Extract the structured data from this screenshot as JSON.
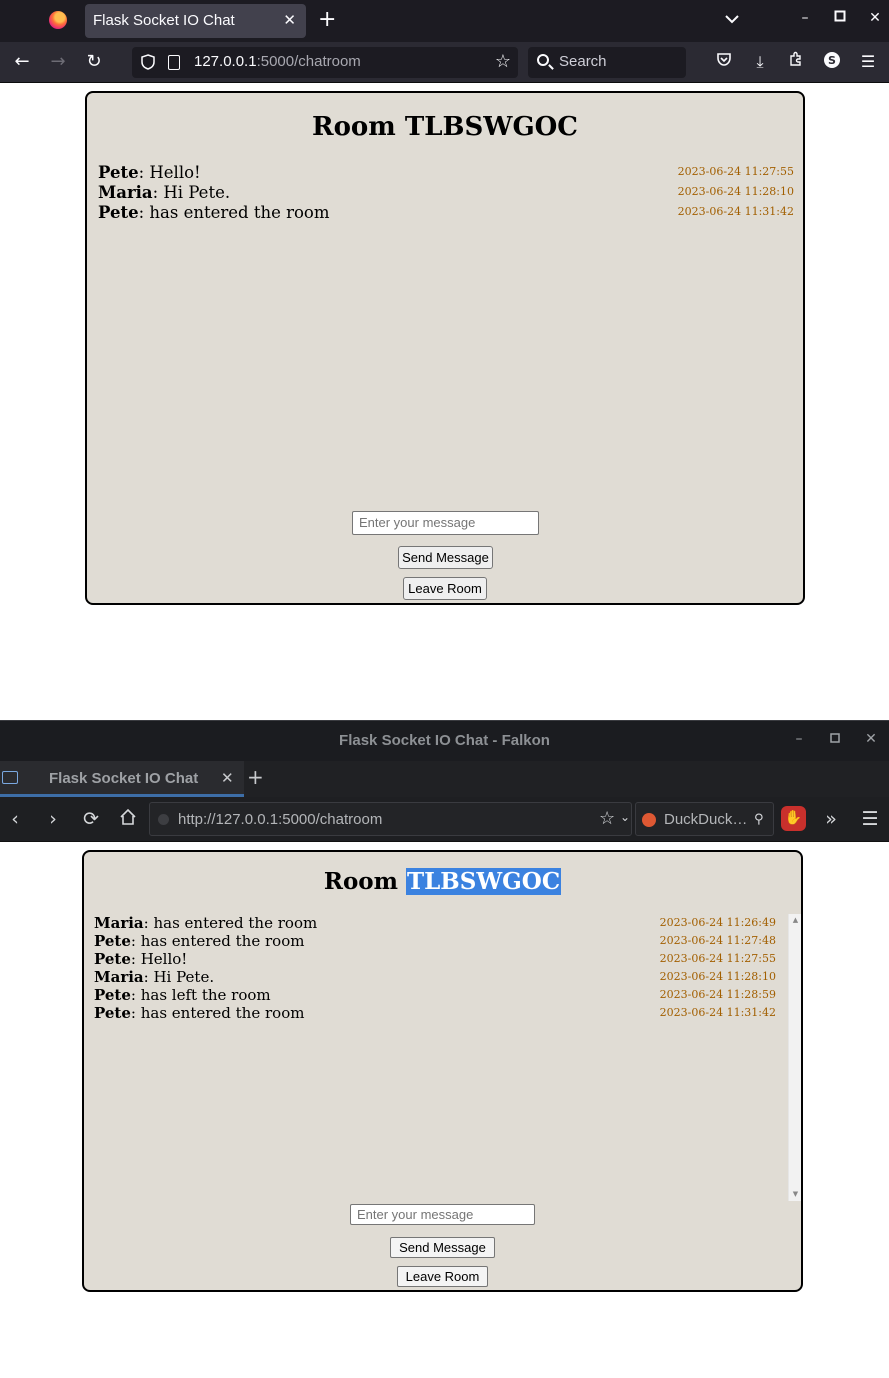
{
  "firefox": {
    "tab_title": "Flask Socket IO Chat",
    "url_host": "127.0.0.1",
    "url_rest": ":5000/chatroom",
    "search_placeholder": "Search",
    "page": {
      "room_label": "Room",
      "room_code": "TLBSWGOC",
      "messages": [
        {
          "user": "Pete",
          "text": ": Hello!",
          "time": "2023-06-24 11:27:55"
        },
        {
          "user": "Maria",
          "text": ": Hi Pete.",
          "time": "2023-06-24 11:28:10"
        },
        {
          "user": "Pete",
          "text": ": has entered the room",
          "time": "2023-06-24 11:31:42"
        }
      ],
      "input_placeholder": "Enter your message",
      "send_label": "Send Message",
      "leave_label": "Leave Room"
    }
  },
  "falkon": {
    "window_title": "Flask Socket IO Chat - Falkon",
    "tab_title": "Flask Socket IO Chat",
    "url": "http://127.0.0.1:5000/chatroom",
    "search_engine": "DuckDuck…",
    "page": {
      "room_label": "Room",
      "room_code": "TLBSWGOC",
      "messages": [
        {
          "user": "Maria",
          "text": ": has entered the room",
          "time": "2023-06-24 11:26:49"
        },
        {
          "user": "Pete",
          "text": ": has entered the room",
          "time": "2023-06-24 11:27:48"
        },
        {
          "user": "Pete",
          "text": ": Hello!",
          "time": "2023-06-24 11:27:55"
        },
        {
          "user": "Maria",
          "text": ": Hi Pete.",
          "time": "2023-06-24 11:28:10"
        },
        {
          "user": "Pete",
          "text": ": has left the room",
          "time": "2023-06-24 11:28:59"
        },
        {
          "user": "Pete",
          "text": ": has entered the room",
          "time": "2023-06-24 11:31:42"
        }
      ],
      "input_placeholder": "Enter your message",
      "send_label": "Send Message",
      "leave_label": "Leave Room"
    }
  },
  "colors": {
    "chat_bg": "#e0dcd4",
    "timestamp": "#a25f00",
    "selection": "#3b82e0"
  }
}
